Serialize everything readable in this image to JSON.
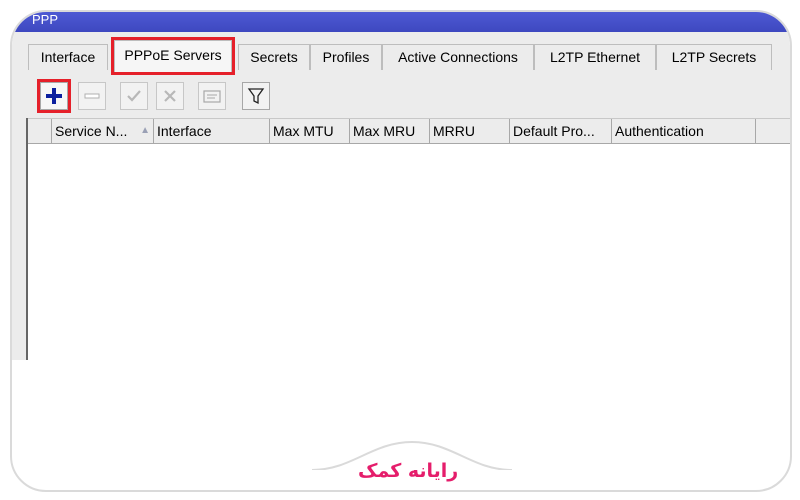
{
  "window": {
    "title": "PPP"
  },
  "tabs": [
    {
      "label": "Interface",
      "active": false
    },
    {
      "label": "PPPoE Servers",
      "active": true
    },
    {
      "label": "Secrets",
      "active": false
    },
    {
      "label": "Profiles",
      "active": false
    },
    {
      "label": "Active Connections",
      "active": false
    },
    {
      "label": "L2TP Ethernet",
      "active": false
    },
    {
      "label": "L2TP Secrets",
      "active": false
    }
  ],
  "toolbar": {
    "buttons": [
      {
        "icon": "plus-icon",
        "enabled": true,
        "highlighted": true
      },
      {
        "icon": "minus-icon",
        "enabled": false
      },
      {
        "icon": "check-icon",
        "enabled": false
      },
      {
        "icon": "cross-icon",
        "enabled": false
      },
      {
        "icon": "comment-icon",
        "enabled": false
      },
      {
        "icon": "filter-icon",
        "enabled": true
      }
    ]
  },
  "table": {
    "columns": [
      "Service N...",
      "Interface",
      "Max MTU",
      "Max MRU",
      "MRRU",
      "Default Pro...",
      "Authentication"
    ],
    "sort_indicator": "▲",
    "rows": []
  },
  "branding": {
    "logo_text": "رایانه کمک"
  },
  "colors": {
    "titlebar": "#4f5bd5",
    "highlight": "#e5202a",
    "logo": "#e51d6b",
    "add_icon": "#0b1f9e"
  }
}
